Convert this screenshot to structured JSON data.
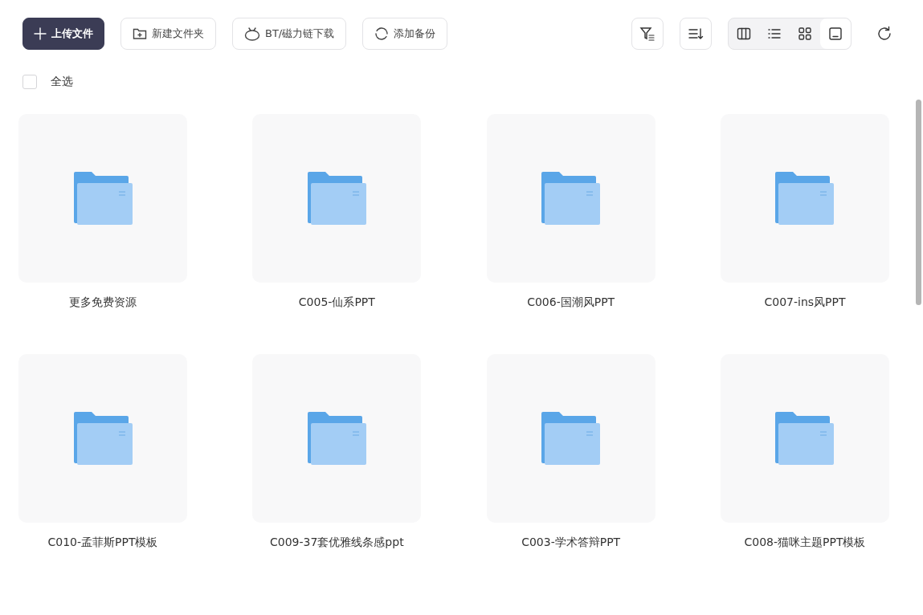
{
  "toolbar": {
    "actions": [
      {
        "label": "上传文件",
        "kind": "primary"
      },
      {
        "label": "新建文件夹",
        "kind": "default"
      },
      {
        "label": "BT/磁力链下载",
        "kind": "default"
      },
      {
        "label": "添加备份",
        "kind": "default"
      }
    ],
    "view_modes": [
      {
        "selected": false
      },
      {
        "selected": false
      },
      {
        "selected": false
      },
      {
        "selected": true
      }
    ]
  },
  "select_all": {
    "label": "全选",
    "checked": false
  },
  "folders": [
    {
      "name": "更多免费资源"
    },
    {
      "name": "C005-仙系PPT"
    },
    {
      "name": "C006-国潮风PPT"
    },
    {
      "name": "C007-ins风PPT"
    },
    {
      "name": "C010-孟菲斯PPT模板"
    },
    {
      "name": "C009-37套优雅线条感ppt"
    },
    {
      "name": "C003-学术答辩PPT"
    },
    {
      "name": "C008-猫咪主题PPT模板"
    }
  ]
}
